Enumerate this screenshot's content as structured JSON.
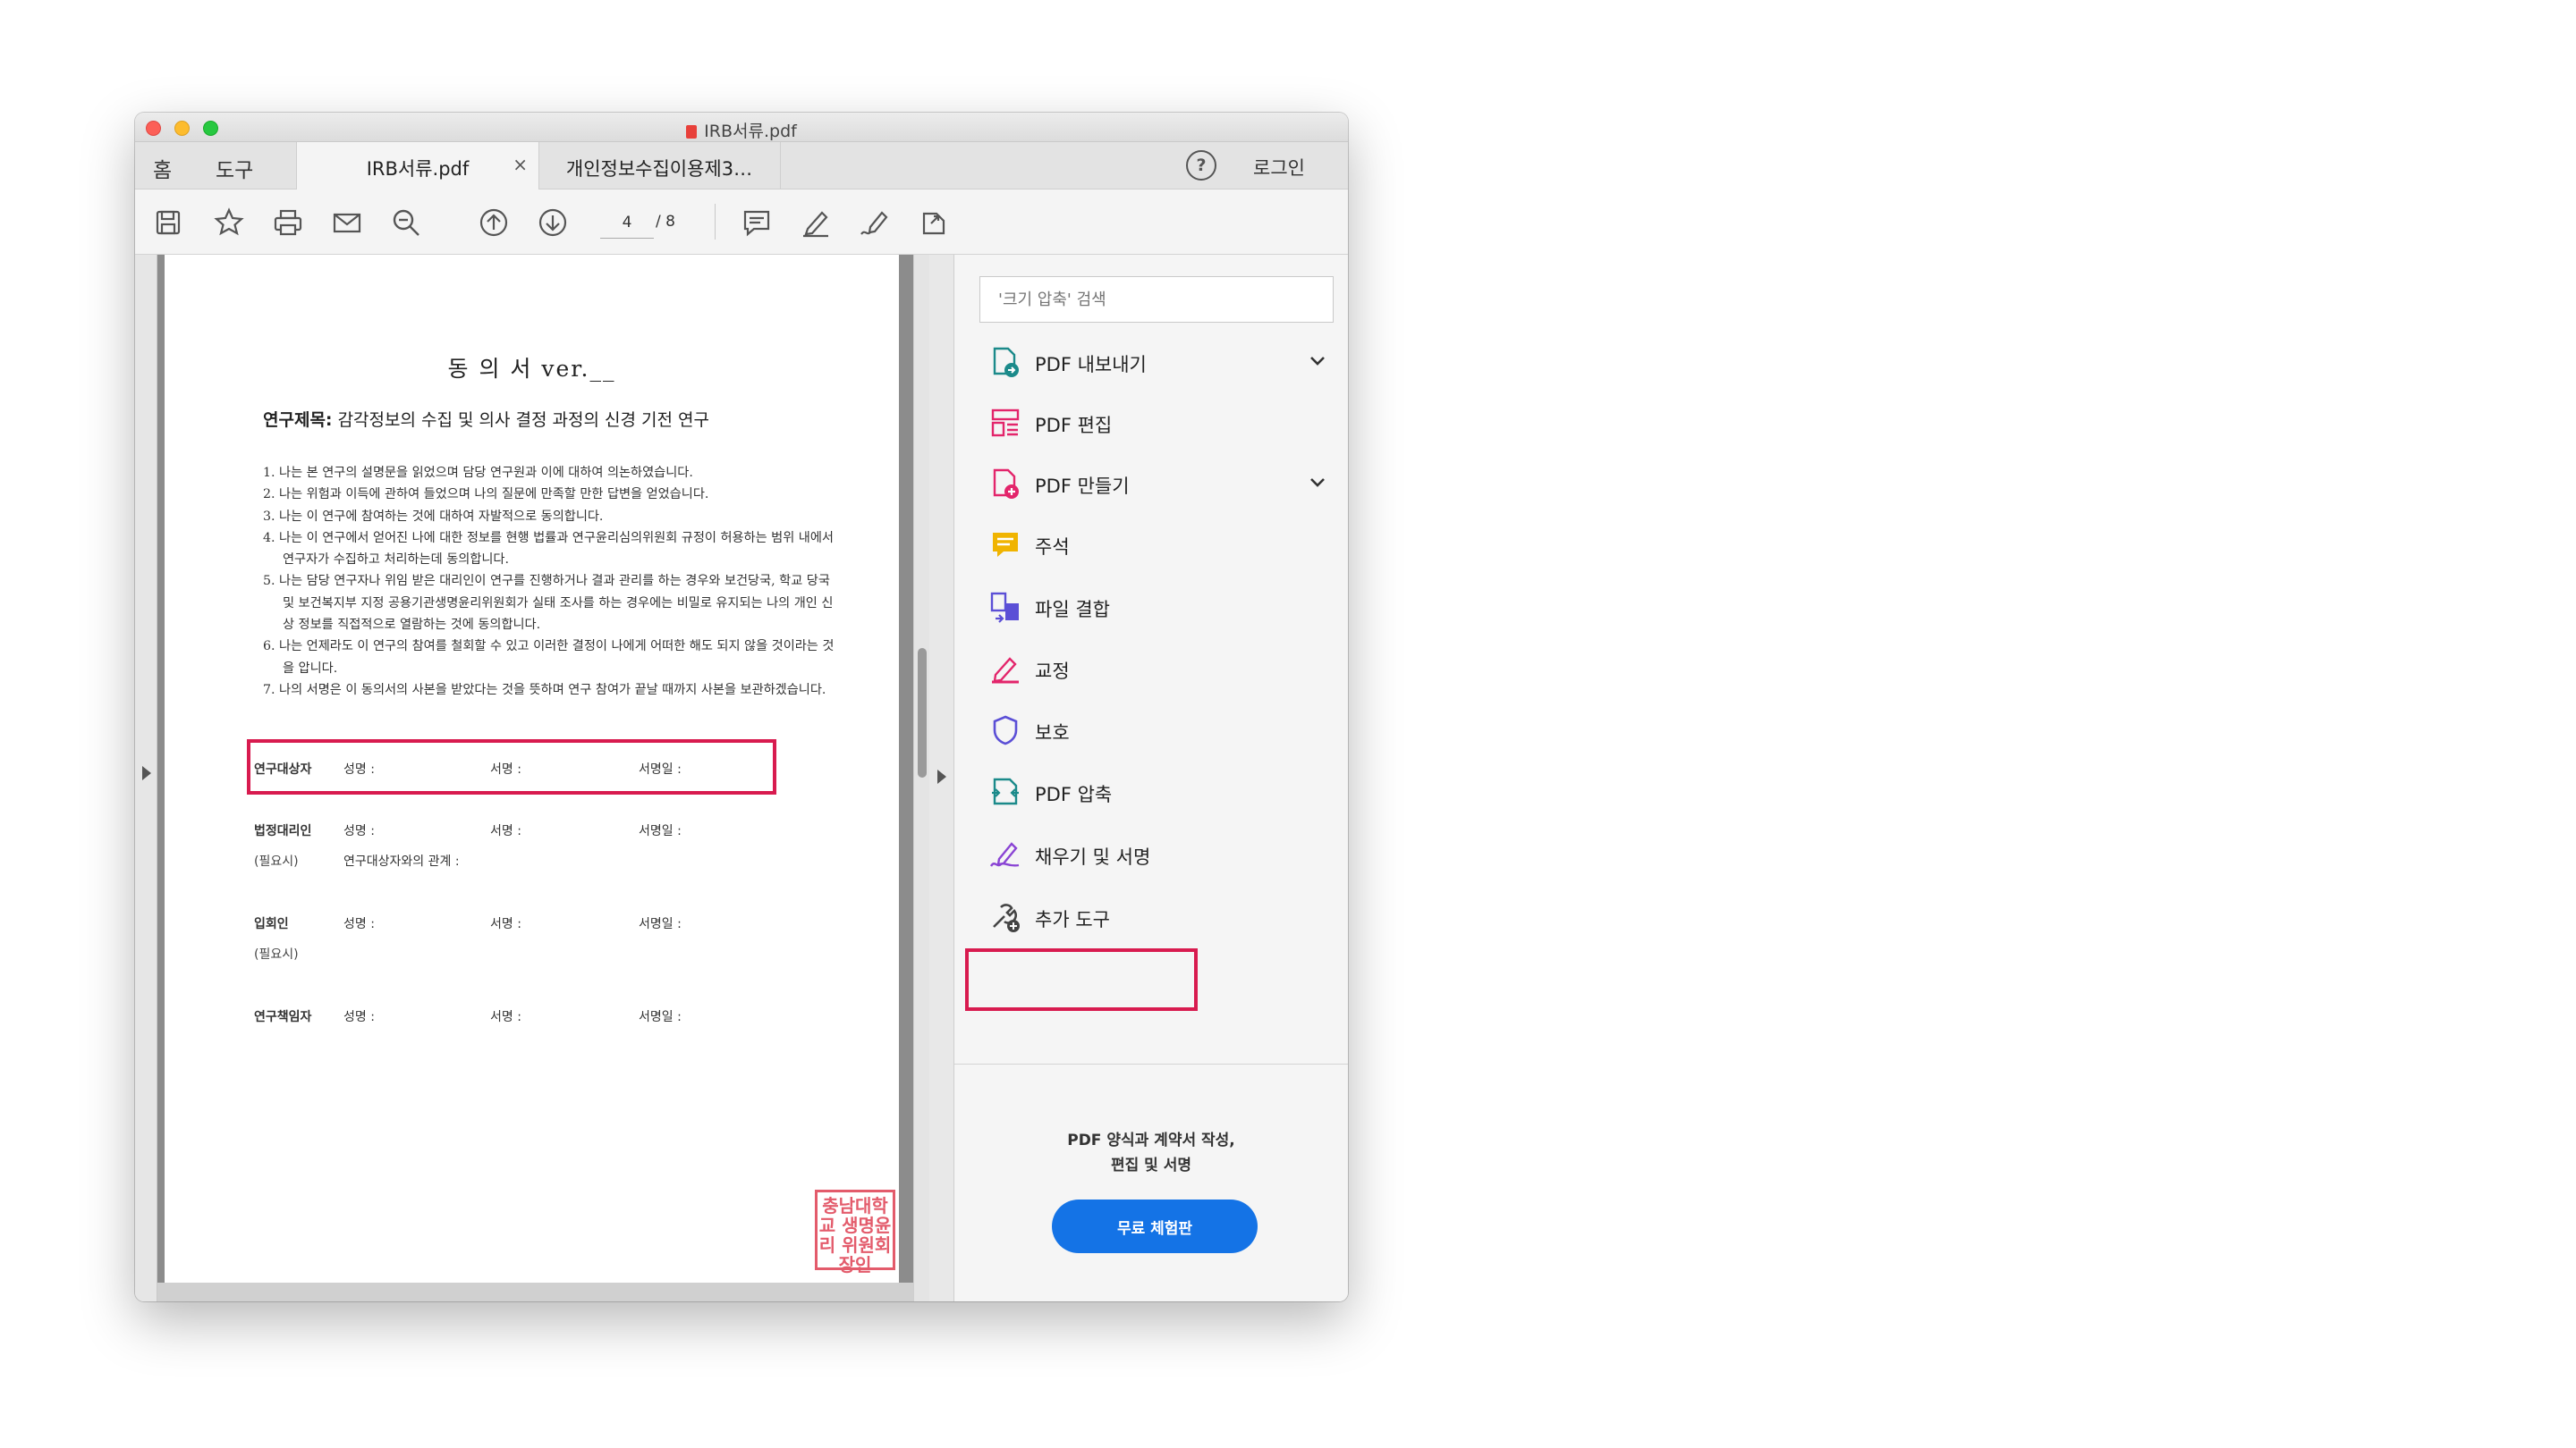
{
  "window": {
    "title": "IRB서류.pdf"
  },
  "tabs": {
    "home": "홈",
    "tools": "도구",
    "documents": [
      {
        "label": "IRB서류.pdf",
        "close": "×"
      },
      {
        "label": "개인정보수집이용제3…"
      }
    ],
    "help": "?",
    "login": "로그인"
  },
  "toolbar": {
    "page_current": "4",
    "page_total": "/ 8"
  },
  "document": {
    "title": "동 의 서   ver.__",
    "research_label": "연구제목:",
    "research_title": " 감각정보의 수집 및 의사 결정 과정의 신경 기전 연구",
    "items": [
      "1. 나는 본 연구의 설명문을 읽었으며 담당 연구원과 이에 대하여 의논하였습니다.",
      "2. 나는 위험과 이득에 관하여 들었으며 나의 질문에 만족할 만한 답변을 얻었습니다.",
      "3. 나는 이 연구에 참여하는 것에 대하여 자발적으로 동의합니다.",
      "4. 나는 이 연구에서 얻어진 나에 대한 정보를 현행 법률과 연구윤리심의위원회 규정이 허용하는 범위 내에서 연구자가 수집하고 처리하는데 동의합니다.",
      "5. 나는 담당 연구자나 위임 받은 대리인이 연구를 진행하거나 결과 관리를 하는 경우와 보건당국, 학교 당국 및 보건복지부 지정 공용기관생명윤리위원회가 실태 조사를 하는 경우에는 비밀로 유지되는 나의 개인 신상 정보를 직접적으로 열람하는 것에 동의합니다.",
      "6. 나는 언제라도 이 연구의 참여를 철회할 수 있고 이러한 결정이 나에게 어떠한 해도 되지 않을 것이라는 것을 압니다.",
      "7. 나의 서명은 이 동의서의 사본을 받았다는 것을 뜻하며 연구 참여가 끝날 때까지 사본을 보관하겠습니다."
    ],
    "signatures": {
      "subject": {
        "role": "연구대상자",
        "name": "성명 :",
        "sign": "서명 :",
        "date": "서명일 :"
      },
      "legal": {
        "role": "법정대리인",
        "sub": "(필요시)",
        "name": "성명 :",
        "relation": "연구대상자와의 관계 :",
        "sign": "서명 :",
        "date": "서명일 :"
      },
      "witness": {
        "role": "입회인",
        "sub": "(필요시)",
        "name": "성명 :",
        "sign": "서명 :",
        "date": "서명일 :"
      },
      "investigator": {
        "role": "연구책임자",
        "name": "성명 :",
        "sign": "서명 :",
        "date": "서명일 :"
      }
    },
    "seal_text": "충남대학교 생명윤리 위원회장인"
  },
  "panel": {
    "search_placeholder": "'크기 압축' 검색",
    "tools": [
      {
        "label": "PDF 내보내기",
        "icon": "pdf-export-icon",
        "expandable": true
      },
      {
        "label": "PDF 편집",
        "icon": "pdf-edit-icon"
      },
      {
        "label": "PDF 만들기",
        "icon": "pdf-create-icon",
        "expandable": true
      },
      {
        "label": "주석",
        "icon": "comment-icon"
      },
      {
        "label": "파일 결합",
        "icon": "combine-files-icon"
      },
      {
        "label": "교정",
        "icon": "redact-icon"
      },
      {
        "label": "보호",
        "icon": "protect-icon"
      },
      {
        "label": "PDF 압축",
        "icon": "compress-pdf-icon"
      },
      {
        "label": "채우기 및 서명",
        "icon": "fill-sign-icon"
      },
      {
        "label": "추가 도구",
        "icon": "more-tools-icon"
      }
    ],
    "promo_line1": "PDF 양식과 계약서 작성,",
    "promo_line2": "편집 및 서명",
    "trial_button": "무료 체험판"
  },
  "colors": {
    "highlight": "#d81b4f",
    "accent": "#1473e6"
  }
}
